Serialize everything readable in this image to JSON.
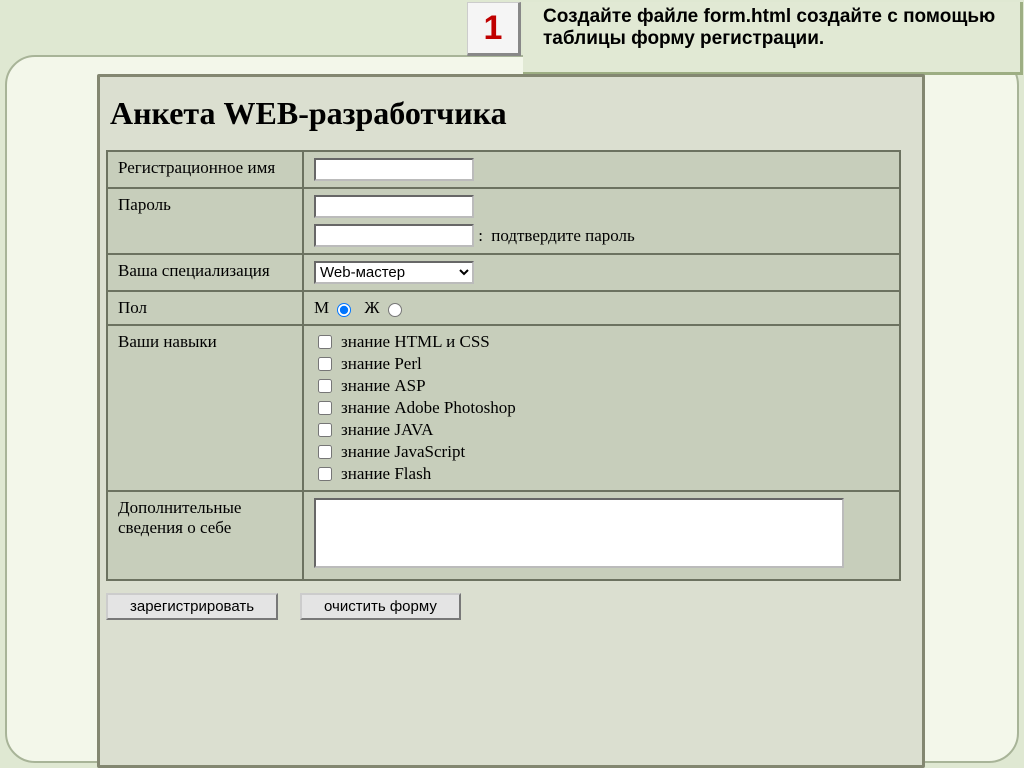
{
  "badge_number": "1",
  "instruction": "Создайте файле form.html создайте с помощью таблицы форму регистрации.",
  "form": {
    "title": "Анкета WEB-разработчика",
    "labels": {
      "reg_name": "Регистрационное имя",
      "password": "Пароль",
      "spec": "Ваша специализация",
      "gender": "Пол",
      "skills": "Ваши навыки",
      "extra": "Дополнительные сведения о себе",
      "confirm_pwd": "подтвердите пароль"
    },
    "gender": {
      "m": "М",
      "f": "Ж"
    },
    "spec_value": "Web-мастер",
    "skills_list": [
      "знание HTML и CSS",
      "знание Perl",
      "знание ASP",
      "знание Adobe Photoshop",
      "знание JAVA",
      "знание JavaScript",
      "знание Flash"
    ],
    "buttons": {
      "submit": "зарегистрировать",
      "reset": "очистить форму"
    }
  }
}
